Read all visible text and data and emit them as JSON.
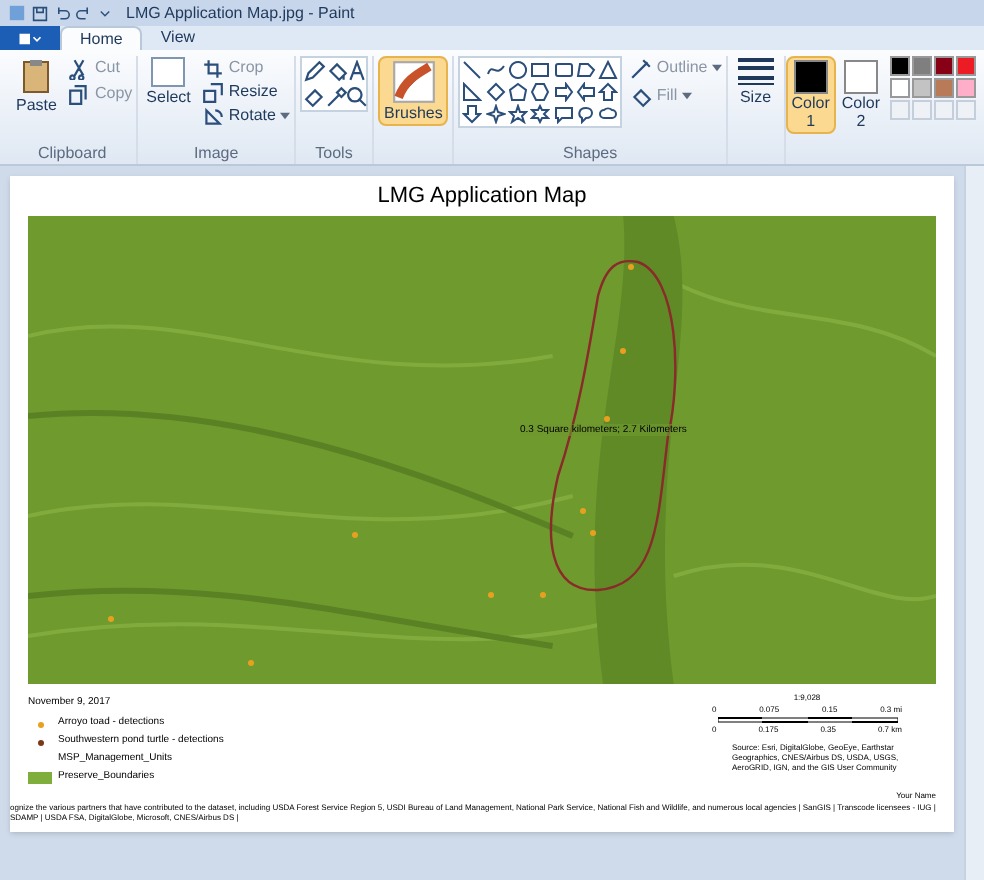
{
  "window": {
    "title": "LMG Application Map.jpg - Paint"
  },
  "tabs": [
    {
      "label": "Home",
      "selected": true
    },
    {
      "label": "View",
      "selected": false
    }
  ],
  "ribbon": {
    "clipboard": {
      "label": "Clipboard",
      "paste": "Paste",
      "cut": "Cut",
      "copy": "Copy"
    },
    "image": {
      "label": "Image",
      "select": "Select",
      "crop": "Crop",
      "resize": "Resize",
      "rotate": "Rotate"
    },
    "tools": {
      "label": "Tools"
    },
    "brushes": {
      "label": "Brushes",
      "selected": true
    },
    "shapes": {
      "label": "Shapes",
      "outline": "Outline",
      "fill": "Fill"
    },
    "size": {
      "label": "Size"
    },
    "color1": {
      "label": "Color",
      "number": "1",
      "selected": true
    },
    "color2": {
      "label": "Color",
      "number": "2",
      "selected": false
    },
    "palette": [
      {
        "color": "#000000"
      },
      {
        "color": "#7f7f7f"
      },
      {
        "color": "#880015"
      },
      {
        "color": "#ed1c24"
      },
      {
        "color": "#ffffff"
      },
      {
        "color": "#c3c3c3"
      },
      {
        "color": "#b97a57"
      },
      {
        "color": "#ffaec9"
      }
    ]
  },
  "map": {
    "title": "LMG Application Map",
    "label": "0.3 Square kilometers;  2.7 Kilometers",
    "date": "November 9, 2017",
    "legend": [
      {
        "kind": "dot",
        "label": "Arroyo toad - detections",
        "color": "#e8a020"
      },
      {
        "kind": "dot",
        "label": "Southwestern pond turtle - detections",
        "color": "#7a3a1a"
      },
      {
        "kind": "outline",
        "label": "MSP_Management_Units"
      },
      {
        "kind": "swatch",
        "label": "Preserve_Boundaries",
        "color": "#7fae3c"
      }
    ],
    "scale": {
      "ratio": "1:9,028",
      "top_ticks": [
        "0",
        "0.075",
        "0.15",
        "0.3 mi"
      ],
      "bottom_ticks": [
        "0",
        "0.175",
        "0.35",
        "0.7 km"
      ]
    },
    "source": "Source: Esri, DigitalGlobe, GeoEye, Earthstar Geographics, CNES/Airbus DS, USDA, USGS, AeroGRID, IGN, and the GIS User Community",
    "author": "Your Name",
    "credits": "ognize the various partners that have contributed to the dataset, including USDA Forest Service Region 5, USDI Bureau of Land Management, National Park Service, National Fish and Wildlife, and numerous local agencies | SanGIS | Transcode licensees - IUG | SDAMP | USDA FSA, DigitalGlobe, Microsoft, CNES/Airbus DS |"
  }
}
